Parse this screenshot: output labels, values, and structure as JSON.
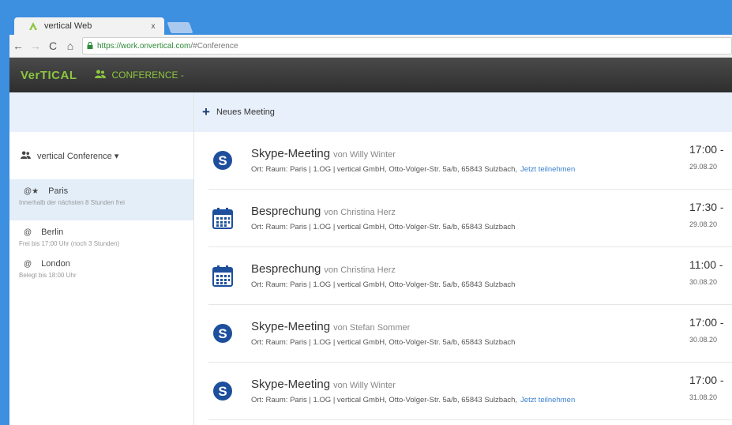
{
  "browser": {
    "tab_title": "vertical Web",
    "tab_close": "x",
    "back": "←",
    "forward": "→",
    "reload": "C",
    "home": "⌂",
    "url_scheme_host": "https://work.onvertical.com",
    "url_path": "/#Conference"
  },
  "app": {
    "logo": "VerTICAL",
    "menu_label": "CONFERENCE -"
  },
  "sidebar": {
    "section_label": "vertical Conference ▾",
    "rooms": [
      {
        "mark": "@★",
        "name": "Paris",
        "status": "Innerhalb der nächsten 8 Stunden frei"
      },
      {
        "mark": "@",
        "name": "Berlin",
        "status": "Frei bis 17:00 Uhr (noch 3 Stunden)"
      },
      {
        "mark": "@",
        "name": "London",
        "status": "Belegt bis 18:00 Uhr"
      }
    ]
  },
  "main": {
    "new_meeting": "Neues Meeting",
    "meetings": [
      {
        "icon": "skype-icon",
        "title": "Skype-Meeting",
        "by": "von Willy Winter",
        "detail": "Ort: Raum: Paris | 1.OG | vertical GmbH, Otto-Volger-Str. 5a/b, 65843 Sulzbach,",
        "join": "Jetzt teilnehmen",
        "time": "17:00 -",
        "date": "29.08.20"
      },
      {
        "icon": "calendar-icon",
        "title": "Besprechung",
        "by": "von Christina Herz",
        "detail": "Ort: Raum: Paris | 1.OG | vertical GmbH, Otto-Volger-Str. 5a/b, 65843 Sulzbach",
        "join": "",
        "time": "17:30 -",
        "date": "29.08.20"
      },
      {
        "icon": "calendar-icon",
        "title": "Besprechung",
        "by": "von Christina Herz",
        "detail": "Ort: Raum: Paris | 1.OG | vertical GmbH, Otto-Volger-Str. 5a/b, 65843 Sulzbach",
        "join": "",
        "time": "11:00 -",
        "date": "30.08.20"
      },
      {
        "icon": "skype-icon",
        "title": "Skype-Meeting",
        "by": "von Stefan Sommer",
        "detail": "Ort: Raum: Paris | 1.OG | vertical GmbH, Otto-Volger-Str. 5a/b, 65843 Sulzbach",
        "join": "",
        "time": "17:00 -",
        "date": "30.08.20"
      },
      {
        "icon": "skype-icon",
        "title": "Skype-Meeting",
        "by": "von Willy Winter",
        "detail": "Ort: Raum: Paris | 1.OG | vertical GmbH, Otto-Volger-Str. 5a/b, 65843 Sulzbach,",
        "join": "Jetzt teilnehmen",
        "time": "17:00 -",
        "date": "31.08.20"
      }
    ]
  },
  "colors": {
    "accent_green": "#8cc63f",
    "link_blue": "#3a7fd0",
    "icon_blue": "#1d4f9c",
    "frame_blue": "#3d8fe0"
  }
}
